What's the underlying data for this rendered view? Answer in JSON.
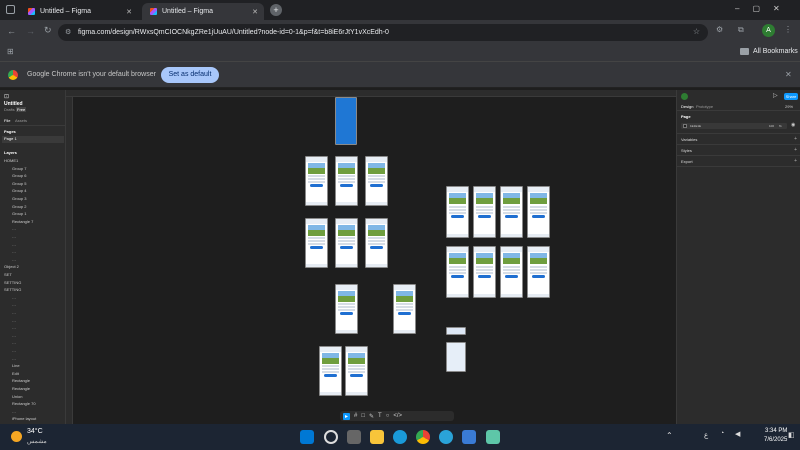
{
  "browser": {
    "tabs": [
      {
        "title": "Untitled – Figma",
        "active": false
      },
      {
        "title": "Untitled – Figma",
        "active": true
      }
    ],
    "new_tab": "+",
    "url": "figma.com/design/RWxsQmCIOCNkgZRe1jUuAU/Untitled?node-id=0-1&p=f&t=b8iE6rJtY1vXcEdh-0",
    "all_bookmarks": "All Bookmarks",
    "profile_initial": "A",
    "default_banner": {
      "text": "Google Chrome isn't your default browser",
      "button": "Set as default"
    }
  },
  "figma": {
    "file_name": "Untitled",
    "file_sub": "Drafts",
    "plan_badge": "Free",
    "left_tabs": [
      "File",
      "Assets"
    ],
    "pages_label": "Pages",
    "page_item": "Page 1",
    "layers_label": "Layers",
    "layers": [
      "HOME1",
      "Group 7",
      "Group 6",
      "Group 5",
      "Group 4",
      "Group 3",
      "Group 2",
      "Group 1",
      "Rectangle 7",
      "…",
      "…",
      "…",
      "…",
      "…",
      "Object 2",
      "SET",
      "SETTING",
      "SETTING",
      "…",
      "…",
      "…",
      "…",
      "…",
      "…",
      "…",
      "…",
      "…",
      "Line",
      "Edit",
      "Rectangle",
      "Rectangle",
      "Union",
      "Rectangle 70",
      "…",
      "iPhone layout"
    ],
    "right_tabs": [
      "Design",
      "Prototype"
    ],
    "zoom": "29%",
    "share_label": "Share",
    "page_section": "Page",
    "color_hex": "1E1E1E",
    "color_opacity": "100",
    "color_unit": "%",
    "sections": [
      "Variables",
      "Styles",
      "Export"
    ],
    "toolbar_tools": [
      "▸",
      "#",
      "□",
      "✎",
      "T",
      "○",
      "</>"
    ]
  },
  "taskbar": {
    "weather_temp": "34°C",
    "weather_desc": "مشمس",
    "time": "3:34 PM",
    "date": "7/6/2025",
    "lang": "ع"
  }
}
